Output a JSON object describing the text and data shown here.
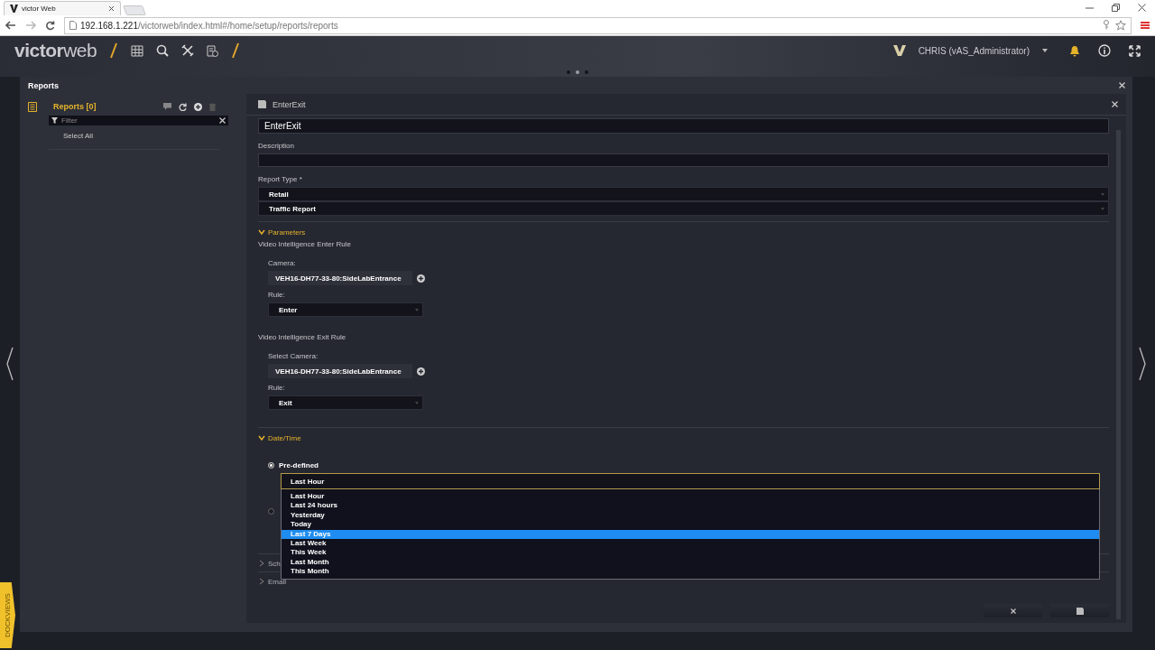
{
  "browser": {
    "tab_title": "victor Web",
    "url_host": "192.168.1.221",
    "url_path": "/victorweb/index.html#/home/setup/reports/reports"
  },
  "app_header": {
    "logo": "**victor**web",
    "user": "CHRIS (vAS_Administrator)"
  },
  "pager": [
    {
      "selected": false
    },
    {
      "selected": true
    },
    {
      "selected": false
    }
  ],
  "panel": {
    "title": "Reports"
  },
  "sidebar": {
    "title": "Reports [0]",
    "filter": {
      "placeholder": "Filter"
    },
    "select_all": "Select All"
  },
  "detail": {
    "title": "EnterExit",
    "name": "EnterExit",
    "description_label": "Description",
    "report_type_label": "Report Type *",
    "report_type": [
      "Retail",
      "Traffic Report"
    ],
    "parameters": {
      "title": "Parameters",
      "expanded": true,
      "rules": [
        {
          "title": "Video Intelligence Enter Rule",
          "camera_label": "Camera:",
          "camera": "VEH16-DH77-33-80:SideLabEntrance",
          "rule_label": "Rule:",
          "rule": "Enter"
        },
        {
          "title": "Video Intelligence Exit Rule",
          "camera_label": "Select Camera:",
          "camera": "VEH16-DH77-33-80:SideLabEntrance",
          "rule_label": "Rule:",
          "rule": "Exit"
        }
      ]
    },
    "datetime": {
      "title": "Date/Time",
      "expanded": true,
      "radios": [
        {
          "label": "Pre-defined",
          "selected": true
        },
        {
          "selected": false
        }
      ],
      "select_value": "Last Hour",
      "options": [
        {
          "label": "Last Hour",
          "selected": false
        },
        {
          "label": "Last 24 hours",
          "selected": false
        },
        {
          "label": "Yesterday",
          "selected": false
        },
        {
          "label": "Today",
          "selected": false
        },
        {
          "label": "Last 7 Days",
          "selected": true
        },
        {
          "label": "Last Week",
          "selected": false
        },
        {
          "label": "This Week",
          "selected": false
        },
        {
          "label": "Last Month",
          "selected": false
        },
        {
          "label": "This Month",
          "selected": false
        }
      ]
    },
    "collapsed_sections": [
      {
        "title": "Sch",
        "expanded": false
      },
      {
        "title": "Email",
        "expanded": false
      }
    ]
  },
  "dock_tab": "DOCKVIEWS"
}
